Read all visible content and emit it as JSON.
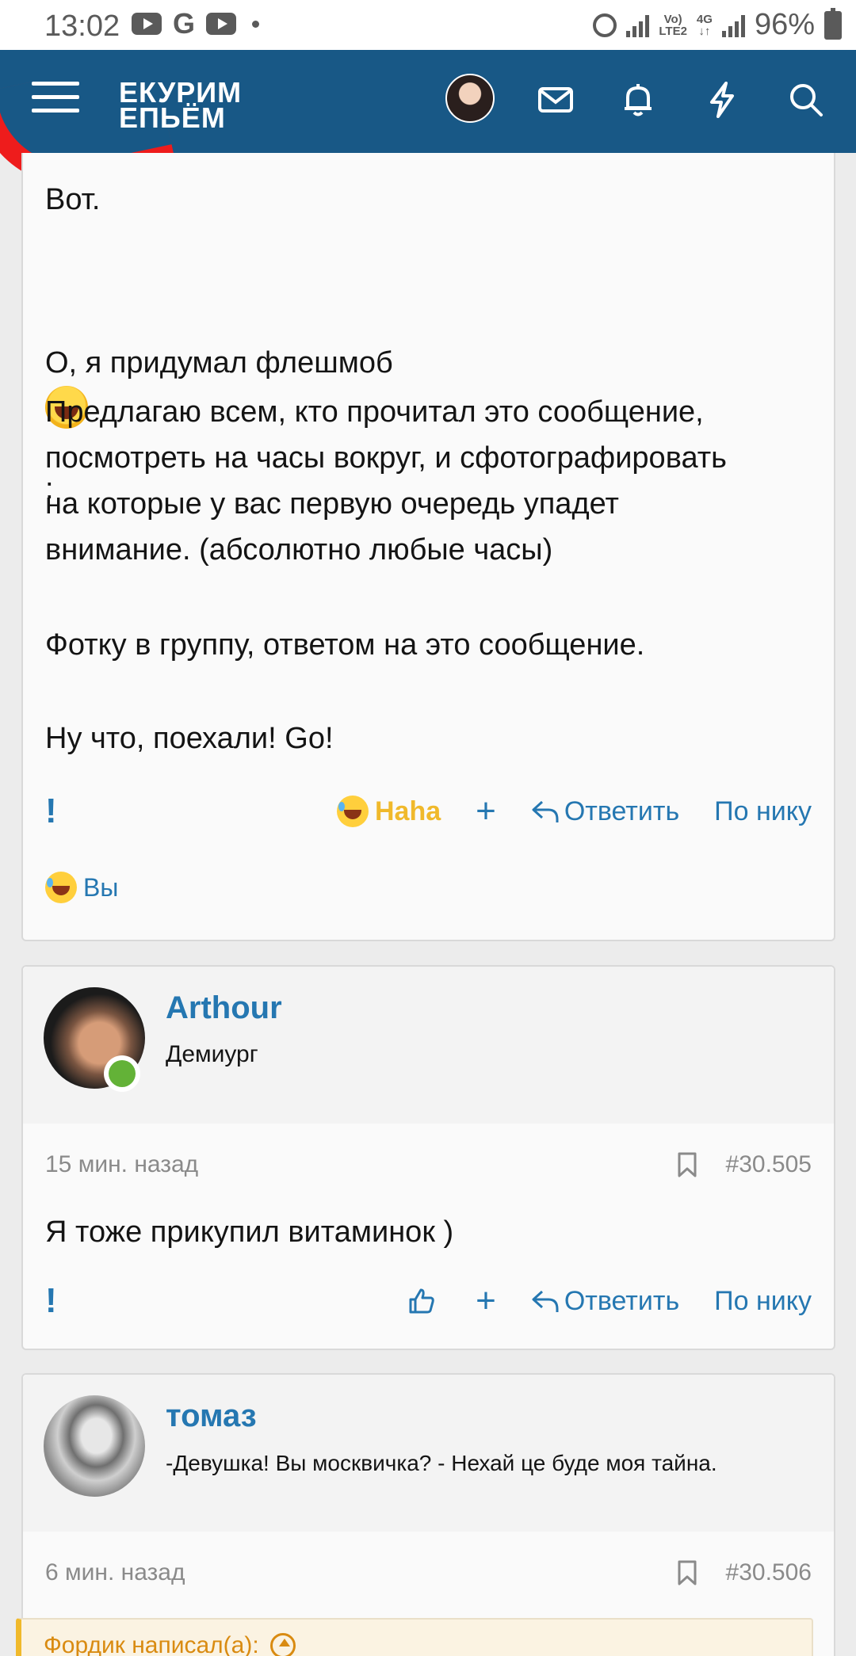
{
  "status_bar": {
    "time": "13:02",
    "google_letter": "G",
    "network_volte": "Vo)",
    "network_lte": "LTE2",
    "network_4g": "4G",
    "battery": "96%"
  },
  "header": {
    "logo_line1": "ЕКУРИМ",
    "logo_line2": "ЕПЬЁМ",
    "accent_color": "#185886"
  },
  "posts": [
    {
      "lines": {
        "l1": "Вот.",
        "l2": "О, я придумал флешмоб",
        "l2_suffix": ":",
        "p3": "Предлагаю всем, кто прочитал это сообщение,\nпосмотреть на часы вокруг, и сфотографировать\nна которые у вас первую очередь упадет\nвнимание. (абсолютно любые часы)",
        "p4": "Фотку в группу, ответом на это сообщение.",
        "p5": "Ну что, поехали! Go!"
      },
      "actions": {
        "report": "!",
        "reaction": "Haha",
        "add": "+",
        "reply": "Ответить",
        "by_nick": "По нику"
      },
      "reacted_by": "Вы"
    },
    {
      "author": "Arthour",
      "user_title": "Демиург",
      "time_ago": "15 мин. назад",
      "post_number": "#30.505",
      "text": "Я тоже прикупил витаминок )",
      "actions": {
        "report": "!",
        "add": "+",
        "reply": "Ответить",
        "by_nick": "По нику"
      }
    },
    {
      "author": "томаз",
      "user_title": "-Девушка! Вы москвичка? - Нехай це буде моя тайна.",
      "time_ago": "6 мин. назад",
      "post_number": "#30.506",
      "quote_header": "Фордик написал(а):"
    }
  ]
}
